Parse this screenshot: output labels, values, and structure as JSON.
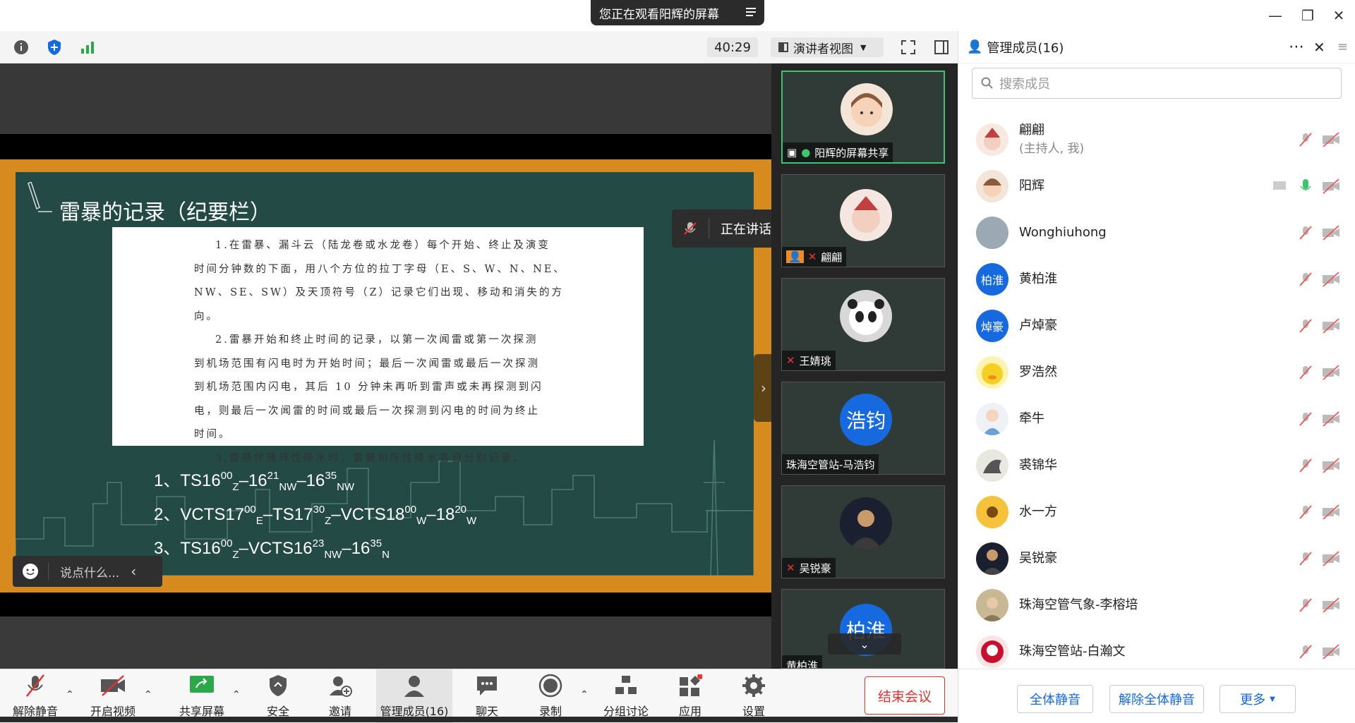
{
  "window": {
    "share_banner": "您正在观看阳辉的屏幕",
    "timer": "40:29",
    "view_mode": "演讲者视图"
  },
  "slide": {
    "title": "雷暴的记录（纪要栏）",
    "doc_lines": [
      "1.在雷暴、漏斗云（陆龙卷或水龙卷）每个开始、终止及演变",
      "时间分钟数的下面，用八个方位的拉丁字母（E、S、W、N、NE、",
      "NW、SE、SW）及天顶符号（Z）记录它们出现、移动和消失的方向。",
      "2.雷暴开始和终止时间的记录，以第一次闻雷或第一次探测",
      "到机场范围有闪电时为开始时间；最后一次闻雷或最后一次探测",
      "到机场范围内闪电，其后 10 分钟未再听到雷声或未再探测到闪",
      "电，则最后一次闻雷的时间或最后一次探测到闪电的时间为终止",
      "时间。",
      "3.雷暴伴随阵性降水时，雷暴和阵性降水各自分别记录。"
    ],
    "formula1": {
      "n": "1、",
      "a": "TS16",
      "a_sup": "00",
      "a_sub": "Z",
      "b": "–16",
      "b_sup": "21",
      "b_sub": "NW",
      "c": "–16",
      "c_sup": "35",
      "c_sub": "NW"
    },
    "formula2": {
      "n": "2、",
      "a": "VCTS17",
      "a_sup": "00",
      "a_sub": "E",
      "b": "–TS17",
      "b_sup": "30",
      "b_sub": "Z",
      "c": "–VCTS18",
      "c_sup": "00",
      "c_sub": "W",
      "d": "–18",
      "d_sup": "20",
      "d_sub": "W"
    },
    "formula3": {
      "n": "3、",
      "a": "TS16",
      "a_sup": "00",
      "a_sub": "Z",
      "b": "–VCTS16",
      "b_sup": "23",
      "b_sub": "NW",
      "c": "–16",
      "c_sup": "35",
      "c_sub": "N"
    }
  },
  "chat": {
    "placeholder": "说点什么..."
  },
  "speaking": {
    "text": "正在讲话: 阳辉;"
  },
  "thumbs": [
    {
      "name": "阳辉的屏幕共享"
    },
    {
      "name": "翩翩"
    },
    {
      "name": "王婧珧"
    },
    {
      "name": "珠海空管站-马浩钧",
      "avatar_text": "浩钧"
    },
    {
      "name": "吴锐豪"
    },
    {
      "name": "黄柏淮",
      "avatar_text": "柏淮"
    }
  ],
  "sidebar": {
    "title": "管理成员(16)",
    "search_placeholder": "搜索成员",
    "members": [
      {
        "name": "翩翩",
        "sub": "(主持人, 我)"
      },
      {
        "name": "阳辉"
      },
      {
        "name": "Wonghiuhong"
      },
      {
        "name": "黄柏淮",
        "avatar_text": "柏淮"
      },
      {
        "name": "卢焯豪",
        "avatar_text": "焯豪"
      },
      {
        "name": "罗浩然"
      },
      {
        "name": "牵牛"
      },
      {
        "name": "裘锦华"
      },
      {
        "name": "水一方"
      },
      {
        "name": "吴锐豪"
      },
      {
        "name": "珠海空管气象-李榕培"
      },
      {
        "name": "珠海空管站-白瀚文"
      }
    ],
    "footer": {
      "mute_all": "全体静音",
      "unmute_all": "解除全体静音",
      "more": "更多"
    }
  },
  "toolbar": {
    "unmute": "解除静音",
    "video": "开启视频",
    "share": "共享屏幕",
    "security": "安全",
    "invite": "邀请",
    "members": "管理成员(16)",
    "chat": "聊天",
    "record": "录制",
    "breakout": "分组讨论",
    "apps": "应用",
    "settings": "设置",
    "end": "结束会议"
  },
  "colors": {
    "accent": "#1769e0",
    "danger": "#d33333",
    "active_border": "#3fc46e",
    "slide_frame": "#d78b1e",
    "board": "#234a45"
  }
}
